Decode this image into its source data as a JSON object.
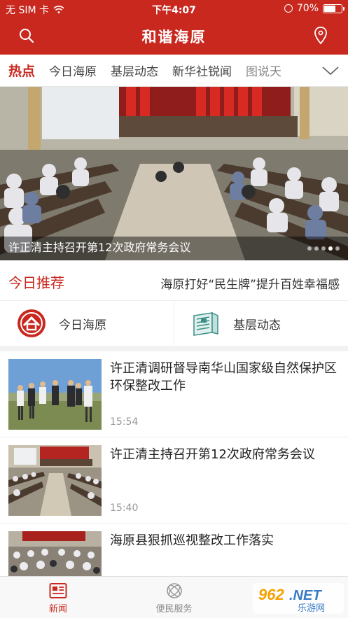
{
  "status_bar": {
    "carrier": "无 SIM 卡",
    "time": "下午4:07",
    "battery": "70%",
    "battery_level": 0.7
  },
  "header": {
    "title": "和谐海原",
    "search_icon": "search-icon",
    "location_icon": "location-pin-icon"
  },
  "tabs": [
    {
      "label": "热点",
      "active": true
    },
    {
      "label": "今日海原"
    },
    {
      "label": "基层动态"
    },
    {
      "label": "新华社锐闻"
    },
    {
      "label": "图说天"
    }
  ],
  "banner": {
    "caption": "许正清主持召开第12次政府常务会议",
    "slide_count": 5,
    "active_slide": 3
  },
  "recommend": {
    "label": "今日推荐",
    "headline": "海原打好“民生牌”提升百姓幸福感"
  },
  "quick_entries": [
    {
      "label": "今日海原",
      "icon": "haiyuan-logo-icon"
    },
    {
      "label": "基层动态",
      "icon": "newspaper-icon"
    }
  ],
  "news": [
    {
      "title": " 许正清调研督导南华山国家级自然保护区环保整改工作",
      "time": "15:54"
    },
    {
      "title": "许正清主持召开第12次政府常务会议",
      "time": "15:40"
    },
    {
      "title": "海原县狠抓巡视整改工作落实",
      "time": ""
    }
  ],
  "bottom_nav": [
    {
      "label": "新闻",
      "icon": "news-icon",
      "active": true
    },
    {
      "label": "便民服务",
      "icon": "service-icon"
    }
  ],
  "watermark": {
    "brand": "962.NET",
    "sub": "乐游网"
  },
  "colors": {
    "brand_red": "#c9281f",
    "divider": "#eeeeee",
    "muted": "#999999"
  }
}
